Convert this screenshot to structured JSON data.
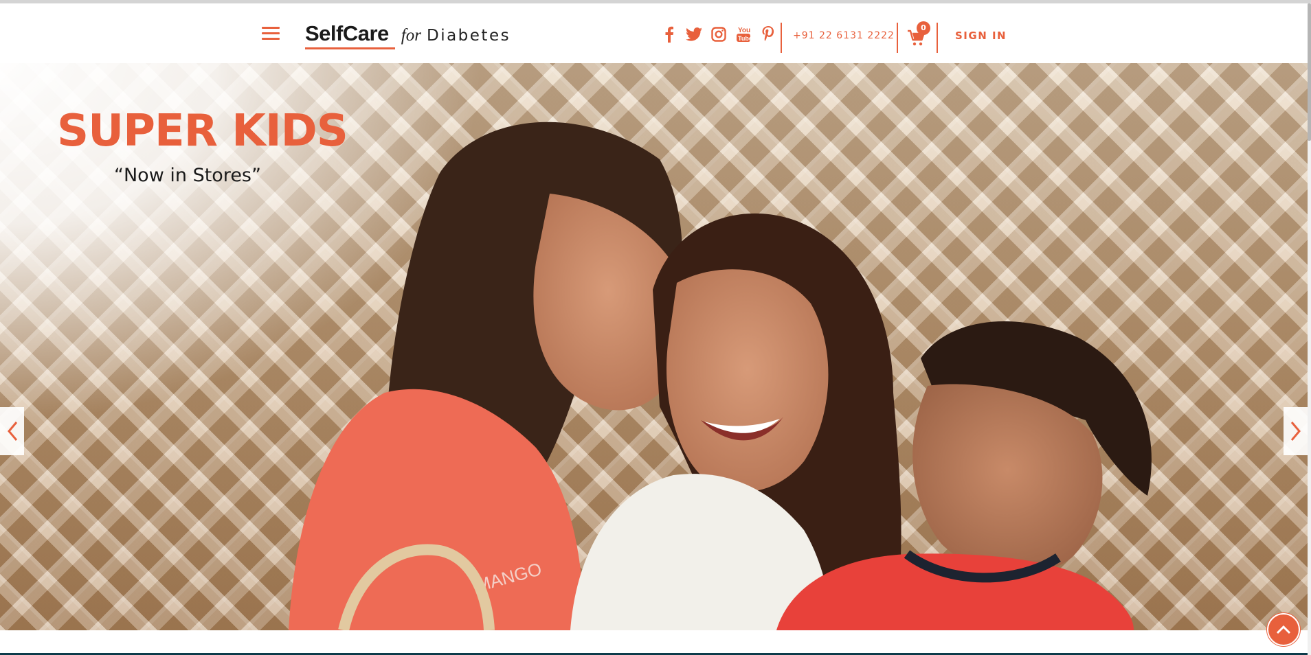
{
  "header": {
    "menu_icon": "hamburger-menu-icon",
    "logo": {
      "brand": "SelfCare",
      "for": "for",
      "product": "Diabetes"
    },
    "social": [
      "facebook-icon",
      "twitter-icon",
      "instagram-icon",
      "youtube-icon",
      "pinterest-icon"
    ],
    "phone": "+91 22 6131 2222",
    "cart": {
      "icon": "cart-icon",
      "count": "0"
    },
    "signin_label": "SIGN IN"
  },
  "hero": {
    "title": "SUPER KIDS",
    "subtitle": "“Now in Stores”",
    "prev_icon": "chevron-left-icon",
    "next_icon": "chevron-right-icon",
    "image": "family-photo"
  },
  "scroll_top_icon": "chevron-up-icon",
  "colors": {
    "accent": "#e8603c",
    "text": "#1a1a1a",
    "footer_line": "#0d3b4a"
  }
}
